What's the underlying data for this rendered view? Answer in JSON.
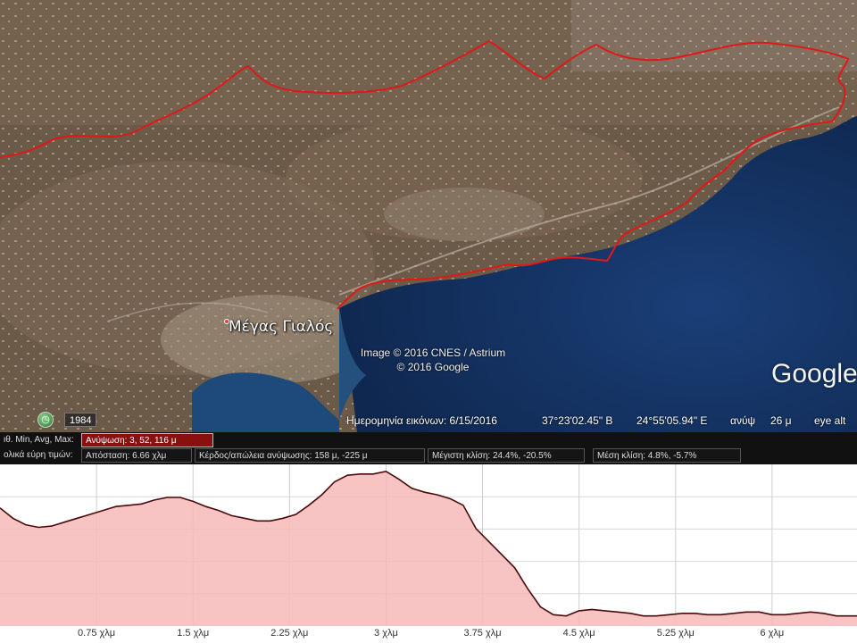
{
  "map": {
    "place_label": "Μέγας Γιαλός",
    "copyright_lines": [
      "Image © 2016 CNES / Astrium",
      "© 2016 Google"
    ],
    "logo": "Google",
    "history_year": "1984",
    "history_icon": "clock-icon",
    "status": {
      "imagery_date": "Ημερομηνία εικόνων: 6/15/2016",
      "lat": "37°23'02.45\" Β",
      "lon": "24°55'05.94\" Ε",
      "elev_label": "ανύψ",
      "elev_value": "26 μ",
      "eye_alt": "eye alt"
    },
    "colors": {
      "path": "#e01818",
      "sea": "#1b3a6b",
      "land": "#6c5a48"
    }
  },
  "stats": {
    "row1_prefix": "ιθ. Min, Avg, Max:",
    "elevation": "Ανύψωση: 3, 52, 116 μ",
    "row2_prefix": "ολικά εύρη τιμών:",
    "distance": "Απόσταση: 6.66 χλμ",
    "gain_loss": "Κέρδος/απώλεια ανύψωσης: 158 μ, -225 μ",
    "max_slope": "Μέγιστη κλίση: 24.4%, -20.5%",
    "avg_slope": "Μέση κλίση: 4.8%, -5.7%"
  },
  "chart_data": {
    "type": "area",
    "title": "",
    "xlabel": "",
    "ylabel": "",
    "x_unit": "χλμ",
    "y_unit": "μ",
    "xlim": [
      0,
      6.66
    ],
    "ylim": [
      0,
      120
    ],
    "x_ticks": [
      0.75,
      1.5,
      2.25,
      3,
      3.75,
      4.5,
      5.25,
      6
    ],
    "x_tick_labels": [
      "0.75 χλμ",
      "1.5 χλμ",
      "2.25 χλμ",
      "3 χλμ",
      "3.75 χλμ",
      "4.5 χλμ",
      "5.25 χλμ",
      "6 χλμ"
    ],
    "grid": true,
    "fill_color": "#f6b9b9",
    "line_color": "#4a0a0a",
    "series": [
      {
        "x": [
          0,
          0.1,
          0.2,
          0.3,
          0.4,
          0.5,
          0.6,
          0.7,
          0.8,
          0.9,
          1.0,
          1.1,
          1.2,
          1.3,
          1.4,
          1.5,
          1.6,
          1.7,
          1.8,
          1.9,
          2.0,
          2.1,
          2.2,
          2.3,
          2.4,
          2.5,
          2.6,
          2.7,
          2.8,
          2.9,
          3.0,
          3.1,
          3.2,
          3.3,
          3.4,
          3.5,
          3.6,
          3.7,
          3.8,
          3.9,
          4.0,
          4.1,
          4.2,
          4.3,
          4.4,
          4.5,
          4.6,
          4.7,
          4.8,
          4.9,
          5.0,
          5.1,
          5.2,
          5.3,
          5.4,
          5.5,
          5.6,
          5.7,
          5.8,
          5.9,
          6.0,
          6.1,
          6.2,
          6.3,
          6.4,
          6.5,
          6.66
        ],
        "y": [
          88,
          80,
          75,
          73,
          74,
          77,
          80,
          83,
          86,
          89,
          90,
          91,
          94,
          96,
          96,
          93,
          89,
          86,
          82,
          80,
          78,
          78,
          80,
          83,
          90,
          98,
          108,
          113,
          114,
          114,
          116,
          110,
          103,
          100,
          98,
          95,
          90,
          72,
          62,
          52,
          42,
          26,
          12,
          6,
          5,
          9,
          10,
          9,
          8,
          7,
          5,
          5,
          6,
          7,
          7,
          6,
          6,
          7,
          8,
          8,
          6,
          6,
          7,
          8,
          7,
          5,
          5
        ]
      }
    ]
  }
}
